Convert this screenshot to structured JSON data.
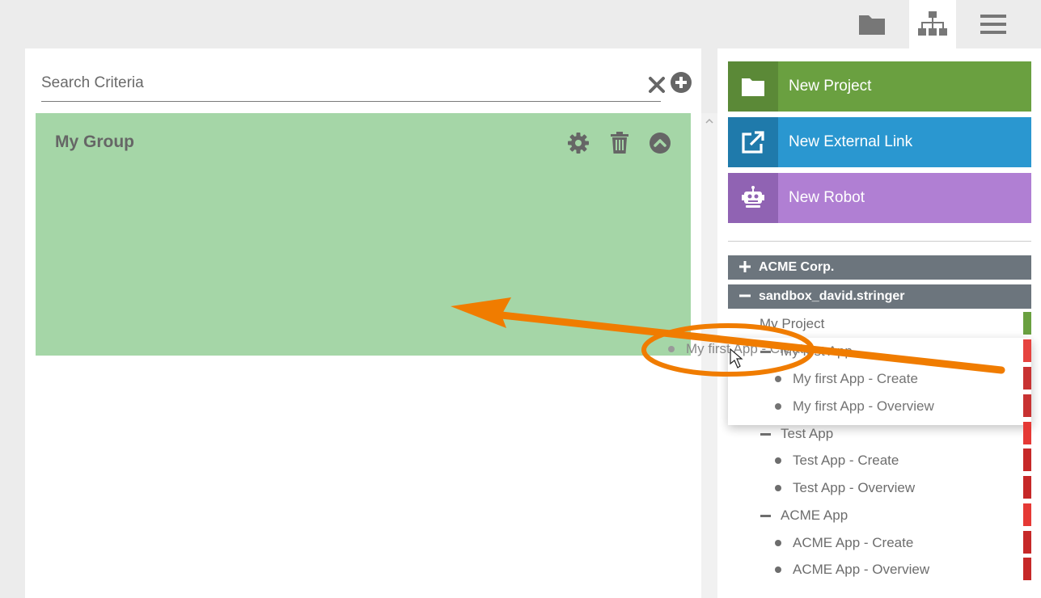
{
  "toolbar": {
    "icons": [
      "folder-icon",
      "sitemap-icon",
      "hamburger-menu-icon"
    ],
    "active": "sitemap-icon"
  },
  "search": {
    "placeholder": "Search Criteria",
    "value": ""
  },
  "group": {
    "title": "My Group",
    "color": "#a5d6a7"
  },
  "actions": [
    {
      "label": "New Project",
      "icon": "folder-icon",
      "color": "#6aa040",
      "icon_bg": "#5b8937"
    },
    {
      "label": "New External Link",
      "icon": "external-link-icon",
      "color": "#2a97d0",
      "icon_bg": "#1f7aab"
    },
    {
      "label": "New Robot",
      "icon": "robot-icon",
      "color": "#b07fd3",
      "icon_bg": "#9063b3"
    }
  ],
  "tree": {
    "orgs": [
      {
        "label": "ACME Corp.",
        "expanded": false
      },
      {
        "label": "sandbox_david.stringer",
        "expanded": true
      }
    ],
    "project": "My Project",
    "apps": [
      {
        "label": "My first App",
        "pages": [
          "My first App - Create",
          "My first App - Overview"
        ]
      },
      {
        "label": "Test App",
        "pages": [
          "Test App - Create",
          "Test App - Overview"
        ]
      },
      {
        "label": "ACME App",
        "pages": [
          "ACME App - Create",
          "ACME App - Overview"
        ]
      }
    ]
  },
  "drag": {
    "label": "My first App - Create"
  },
  "colors": {
    "project_bar": "#6aa040",
    "app_bar": "#e53935",
    "page_bar": "#c62828",
    "annotation": "#f07c00"
  }
}
